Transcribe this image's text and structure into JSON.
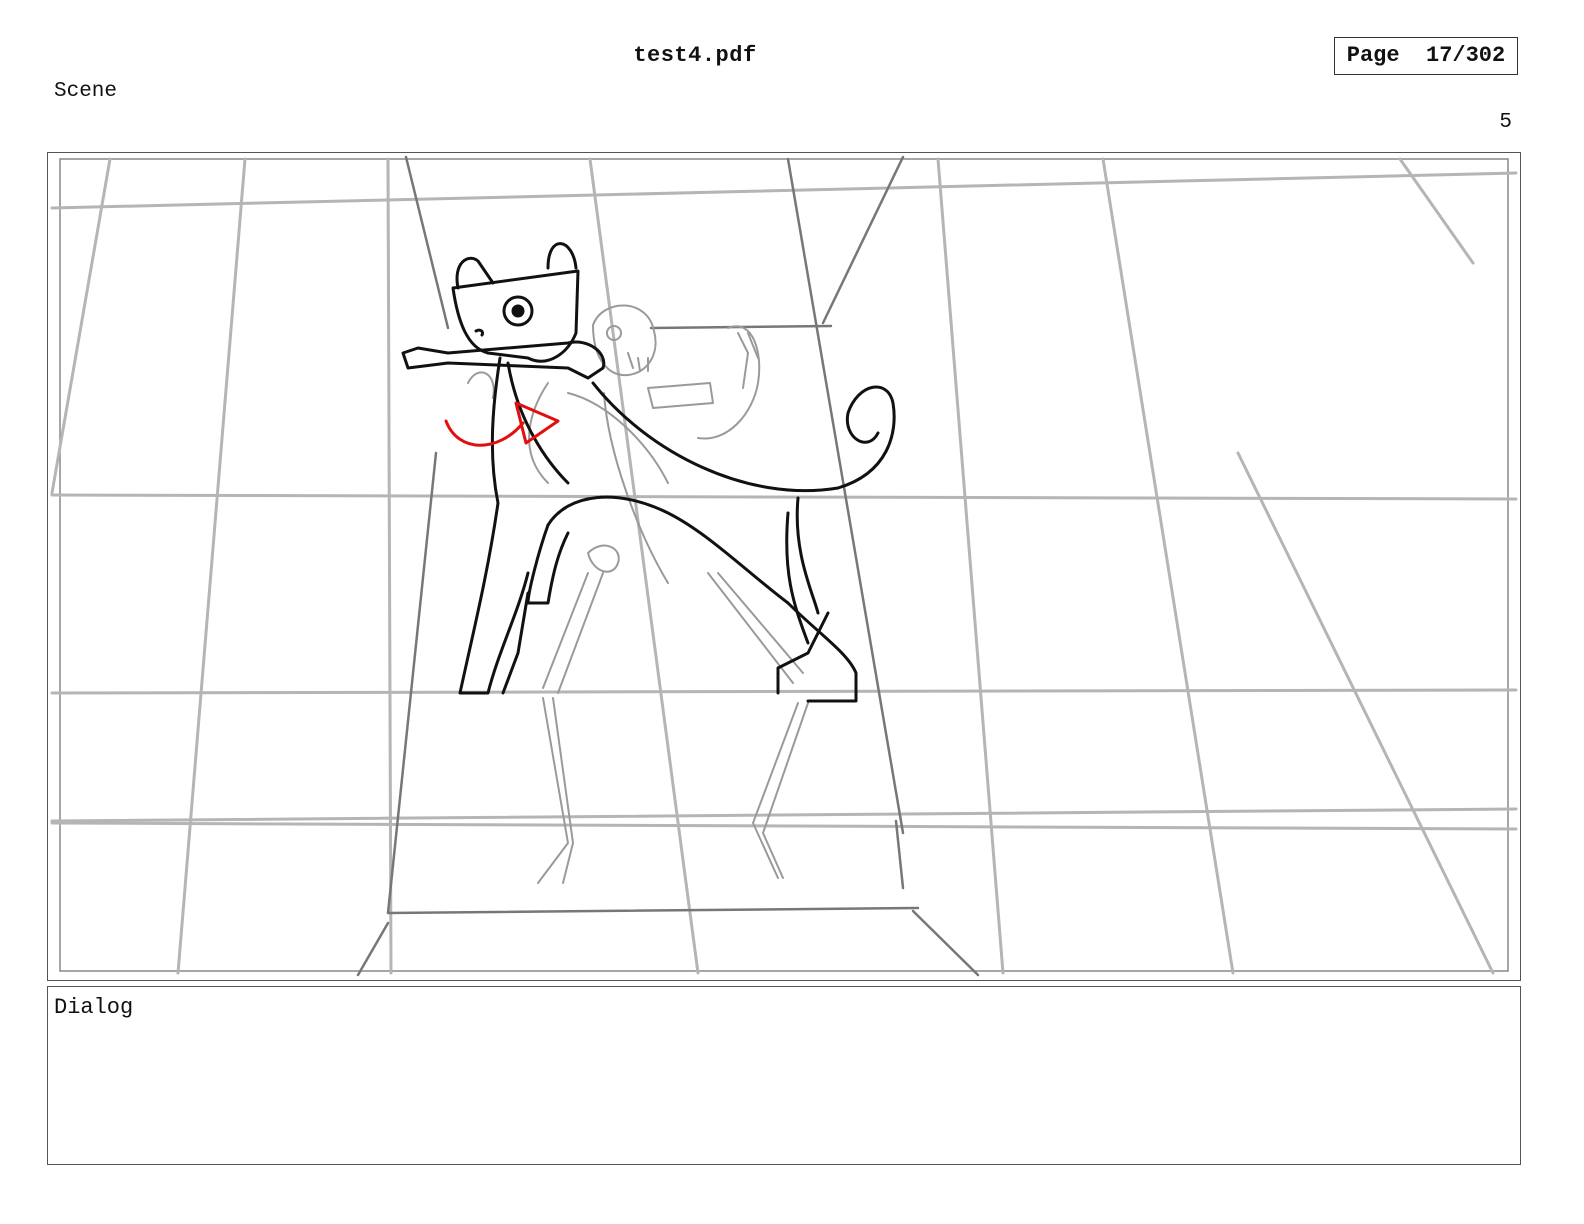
{
  "header": {
    "file_name": "test4.pdf",
    "page_label": "Page",
    "page_counter": "17/302"
  },
  "scene": {
    "label": "Scene",
    "number": "5"
  },
  "panel": {
    "drawing": "storyboard-sketch",
    "colors": {
      "grid": "#b5b5b5",
      "ink": "#111111",
      "skeleton": "#9a9a9a",
      "arrow": "#e01010"
    }
  },
  "dialog": {
    "label": "Dialog",
    "text": ""
  }
}
